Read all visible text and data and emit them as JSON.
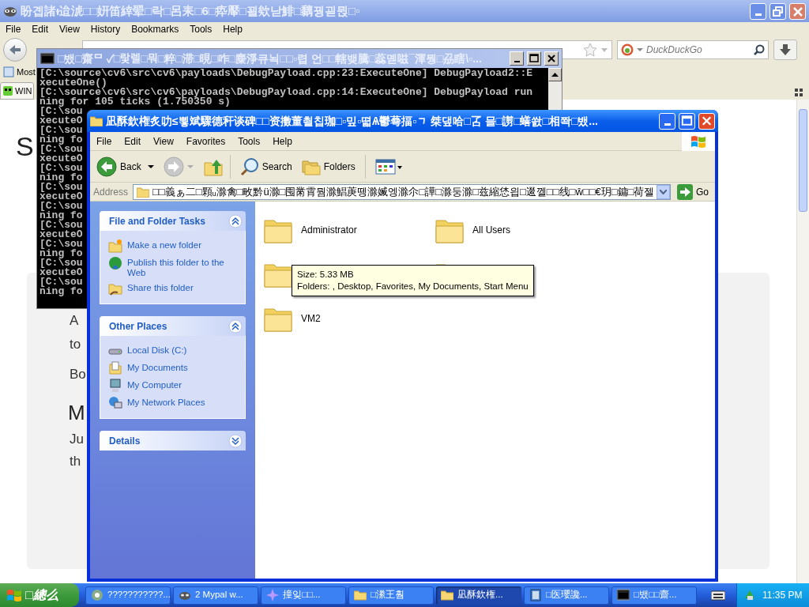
{
  "browser": {
    "title": "盼곕諸ᵻ迨淲□□姸笛緈翚□락□呂耒□6□疩厴□꾈欸낟鯡□黐꿩괻뮍□▫",
    "menu": [
      "File",
      "Edit",
      "View",
      "History",
      "Bookmarks",
      "Tools",
      "Help"
    ],
    "search": {
      "placeholder": "DuckDuckGo"
    },
    "bookmarks": [
      "Most"
    ],
    "tabs": [
      {
        "label": "WIN",
        "selected": true
      }
    ],
    "page": {
      "heading": "S",
      "texts": [
        "A",
        "to",
        "Bo"
      ],
      "subheading": "M",
      "texts2": [
        "Ju",
        "th"
      ]
    }
  },
  "console": {
    "title": "□뱄□齋ᄆ ✓□랓렐□뭐□粹□滞□晛□咋□麋淨큐뇍□□▫렵 언□□轄뱆騰□蕊몓嗞¯渾뭥□刕瞎\\▫...",
    "lines": [
      "[C:\\source\\cv6\\src\\cv6\\payloads\\DebugPayload.cpp:23:ExecuteOne] DebugPayload2::E",
      "xecuteOne()",
      "[C:\\source\\cv6\\src\\cv6\\payloads\\DebugPayload.cpp:14:ExecuteOne] DebugPayload run",
      "ning for 105 ticks (1.750350 s)",
      "[C:\\sou",
      "xecuteO",
      "[C:\\sou",
      "ning fo",
      "[C:\\sou",
      "xecuteO",
      "[C:\\sou",
      "ning fo",
      "[C:\\sou",
      "xecuteO",
      "[C:\\sou",
      "ning fo",
      "[C:\\sou",
      "xecuteO",
      "[C:\\sou",
      "ning fo",
      "[C:\\sou",
      "xecuteO",
      "[C:\\sou",
      "ning fo"
    ]
  },
  "explorer": {
    "title": "凪酥欽権炙叻≤뾯斌驟德秆谈碑□□资擻董쵤칩珈□▫밒▫뗣Ѧ鬱蕚揊▫ᆨ 桀댚哈□叾 믈□謭□蟮쐀□相쫙□뱄...",
    "menu": [
      "File",
      "Edit",
      "View",
      "Favorites",
      "Tools",
      "Help"
    ],
    "toolbar": {
      "back": "Back",
      "search": "Search",
      "folders": "Folders"
    },
    "address": {
      "label": "Address",
      "value": "□□義ぁ二□顆ᵤ滁禽□畋黔ü滁□囤黹霄뭠滁鯧菮뗑滁媙엥滁尒□譁□滁둥滁□兹縮恷읩□逫껠□□线□ŵ□□€玥□鏞□荷젤",
      "go": "Go"
    },
    "panels": [
      {
        "title": "File and Folder Tasks",
        "expanded": true,
        "items": [
          "Make a new folder",
          "Publish this folder to the Web",
          "Share this folder"
        ]
      },
      {
        "title": "Other Places",
        "expanded": true,
        "items": [
          "Local Disk (C:)",
          "My Documents",
          "My Computer",
          "My Network Places"
        ]
      },
      {
        "title": "Details",
        "expanded": false
      }
    ],
    "items": [
      {
        "kind": "folder",
        "name": "Administrator"
      },
      {
        "kind": "folder",
        "name": "All Users"
      },
      {
        "kind": "folder"
      },
      {
        "kind": "folder"
      },
      {
        "kind": "folder",
        "name": "VM2"
      }
    ],
    "tooltip": [
      "Size: 5.33 MB",
      "Folders: , Desktop, Favorites, My Documents, Start Menu"
    ]
  },
  "taskbar": {
    "start": "□總么",
    "tasks": [
      {
        "label": "???????????...",
        "selected": false
      },
      {
        "label": "2 Mypal w...",
        "selected": false
      },
      {
        "label": "撞잊□□...",
        "selected": false
      },
      {
        "label": "□潫王훰",
        "selected": false
      },
      {
        "label": "凪酥欽権...",
        "selected": true
      },
      {
        "label": "□医瓔讒...",
        "selected": false
      },
      {
        "label": "□뱄□□齋...",
        "selected": false
      }
    ],
    "clock": "11:35 PM"
  }
}
